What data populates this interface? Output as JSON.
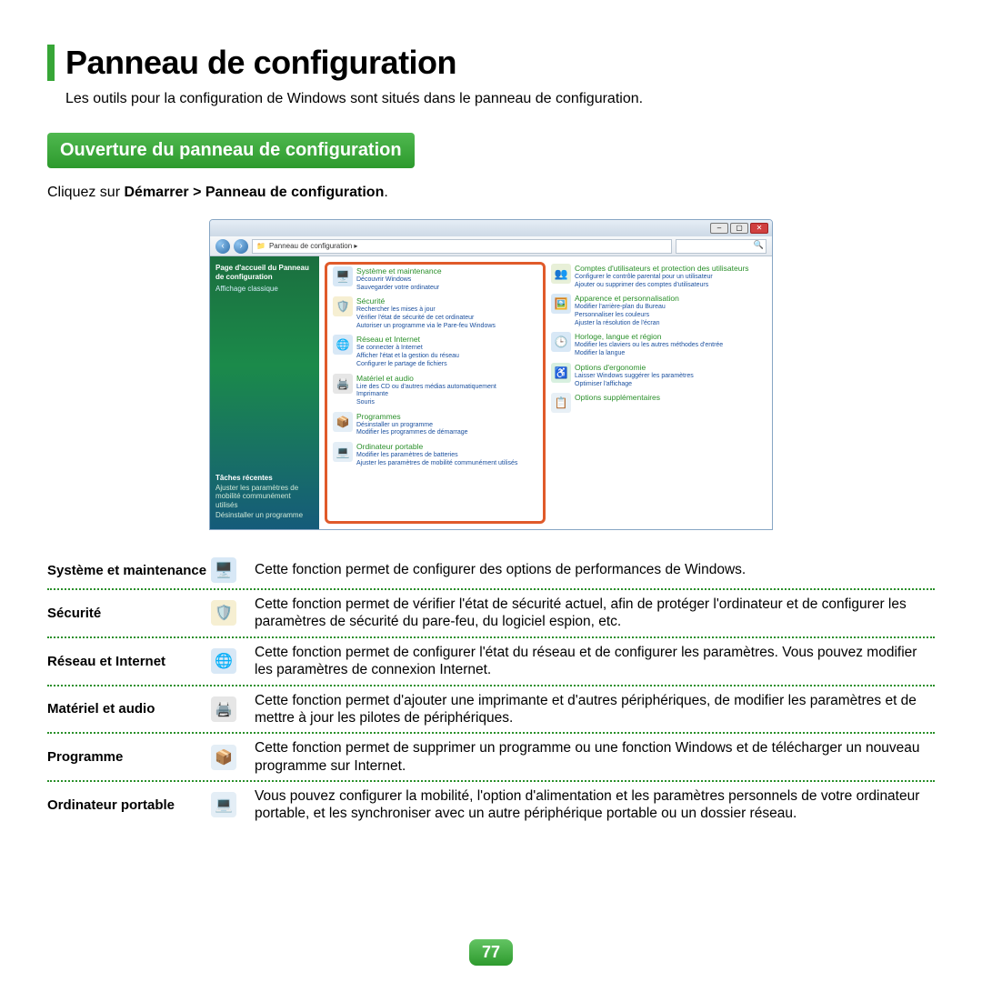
{
  "page": {
    "title": "Panneau de configuration",
    "intro": "Les outils pour la configuration de Windows sont situés dans le panneau de configuration.",
    "number": "77"
  },
  "section": {
    "banner": "Ouverture du panneau de configuration",
    "instruction_prefix": "Cliquez sur ",
    "instruction_bold": "Démarrer > Panneau de configuration",
    "instruction_suffix": "."
  },
  "cp_window": {
    "breadcrumb": "Panneau de configuration  ▸",
    "sidebar": {
      "home": "Page d'accueil du Panneau de configuration",
      "classic": "Affichage classique",
      "tasks_head": "Tâches récentes",
      "task1": "Ajuster les paramètres de mobilité communément utilisés",
      "task2": "Désinstaller un programme"
    },
    "left_col": [
      {
        "title": "Système et maintenance",
        "subs": [
          "Découvrir Windows",
          "Sauvegarder votre ordinateur"
        ],
        "icon": "🖥️",
        "bg": "#d8e8f6"
      },
      {
        "title": "Sécurité",
        "subs": [
          "Rechercher les mises à jour",
          "Vérifier l'état de sécurité de cet ordinateur",
          "Autoriser un programme via le Pare-feu Windows"
        ],
        "icon": "🛡️",
        "bg": "#f6efd2"
      },
      {
        "title": "Réseau et Internet",
        "subs": [
          "Se connecter à Internet",
          "Afficher l'état et la gestion du réseau",
          "Configurer le partage de fichiers"
        ],
        "icon": "🌐",
        "bg": "#d8e8f6"
      },
      {
        "title": "Matériel et audio",
        "subs": [
          "Lire des CD ou d'autres médias automatiquement",
          "Imprimante",
          "Souris"
        ],
        "icon": "🖨️",
        "bg": "#e6e6e6"
      },
      {
        "title": "Programmes",
        "subs": [
          "Désinstaller un programme",
          "Modifier les programmes de démarrage"
        ],
        "icon": "📦",
        "bg": "#e4eef6"
      },
      {
        "title": "Ordinateur portable",
        "subs": [
          "Modifier les paramètres de batteries",
          "Ajuster les paramètres de mobilité communément utilisés"
        ],
        "icon": "💻",
        "bg": "#e4eef6"
      }
    ],
    "right_col": [
      {
        "title": "Comptes d'utilisateurs et protection des utilisateurs",
        "subs": [
          "Configurer le contrôle parental pour un utilisateur",
          "Ajouter ou supprimer des comptes d'utilisateurs"
        ],
        "icon": "👥",
        "bg": "#e8f0d8"
      },
      {
        "title": "Apparence et personnalisation",
        "subs": [
          "Modifier l'arrière-plan du Bureau",
          "Personnaliser les couleurs",
          "Ajuster la résolution de l'écran"
        ],
        "icon": "🖼️",
        "bg": "#d8e8f6"
      },
      {
        "title": "Horloge, langue et région",
        "subs": [
          "Modifier les claviers ou les autres méthodes d'entrée",
          "Modifier la langue"
        ],
        "icon": "🕒",
        "bg": "#d8e8f6"
      },
      {
        "title": "Options d'ergonomie",
        "subs": [
          "Laisser Windows suggérer les paramètres",
          "Optimiser l'affichage"
        ],
        "icon": "♿",
        "bg": "#d8f0e0"
      },
      {
        "title": "Options supplémentaires",
        "subs": [],
        "icon": "📋",
        "bg": "#e8f0f6"
      }
    ]
  },
  "table": [
    {
      "label": "Système et maintenance",
      "icon": "🖥️",
      "bg": "#d8e8f6",
      "desc": "Cette fonction permet de configurer des options de performances de Windows."
    },
    {
      "label": "Sécurité",
      "icon": "🛡️",
      "bg": "#f6efd2",
      "desc": "Cette fonction permet de vérifier l'état de sécurité actuel, afin de protéger l'ordinateur et de configurer les paramètres de sécurité du pare-feu, du logiciel espion, etc."
    },
    {
      "label": "Réseau et Internet",
      "icon": "🌐",
      "bg": "#d8e8f6",
      "desc": "Cette fonction permet de configurer l'état du réseau et de configurer les paramètres. Vous pouvez modifier les paramètres de connexion Internet."
    },
    {
      "label": "Matériel et audio",
      "icon": "🖨️",
      "bg": "#e6e6e6",
      "desc": "Cette fonction permet d'ajouter une imprimante et d'autres périphériques, de modifier les paramètres et de mettre à jour les pilotes de périphériques."
    },
    {
      "label": "Programme",
      "icon": "📦",
      "bg": "#e4eef6",
      "desc": "Cette fonction permet de supprimer un programme ou une fonction Windows et de télécharger un nouveau programme sur Internet."
    },
    {
      "label": "Ordinateur portable",
      "icon": "💻",
      "bg": "#e4eef6",
      "desc": "Vous pouvez configurer la mobilité, l'option d'alimentation et les paramètres personnels de votre ordinateur portable, et les synchroniser avec un autre périphérique portable ou un dossier réseau."
    }
  ]
}
